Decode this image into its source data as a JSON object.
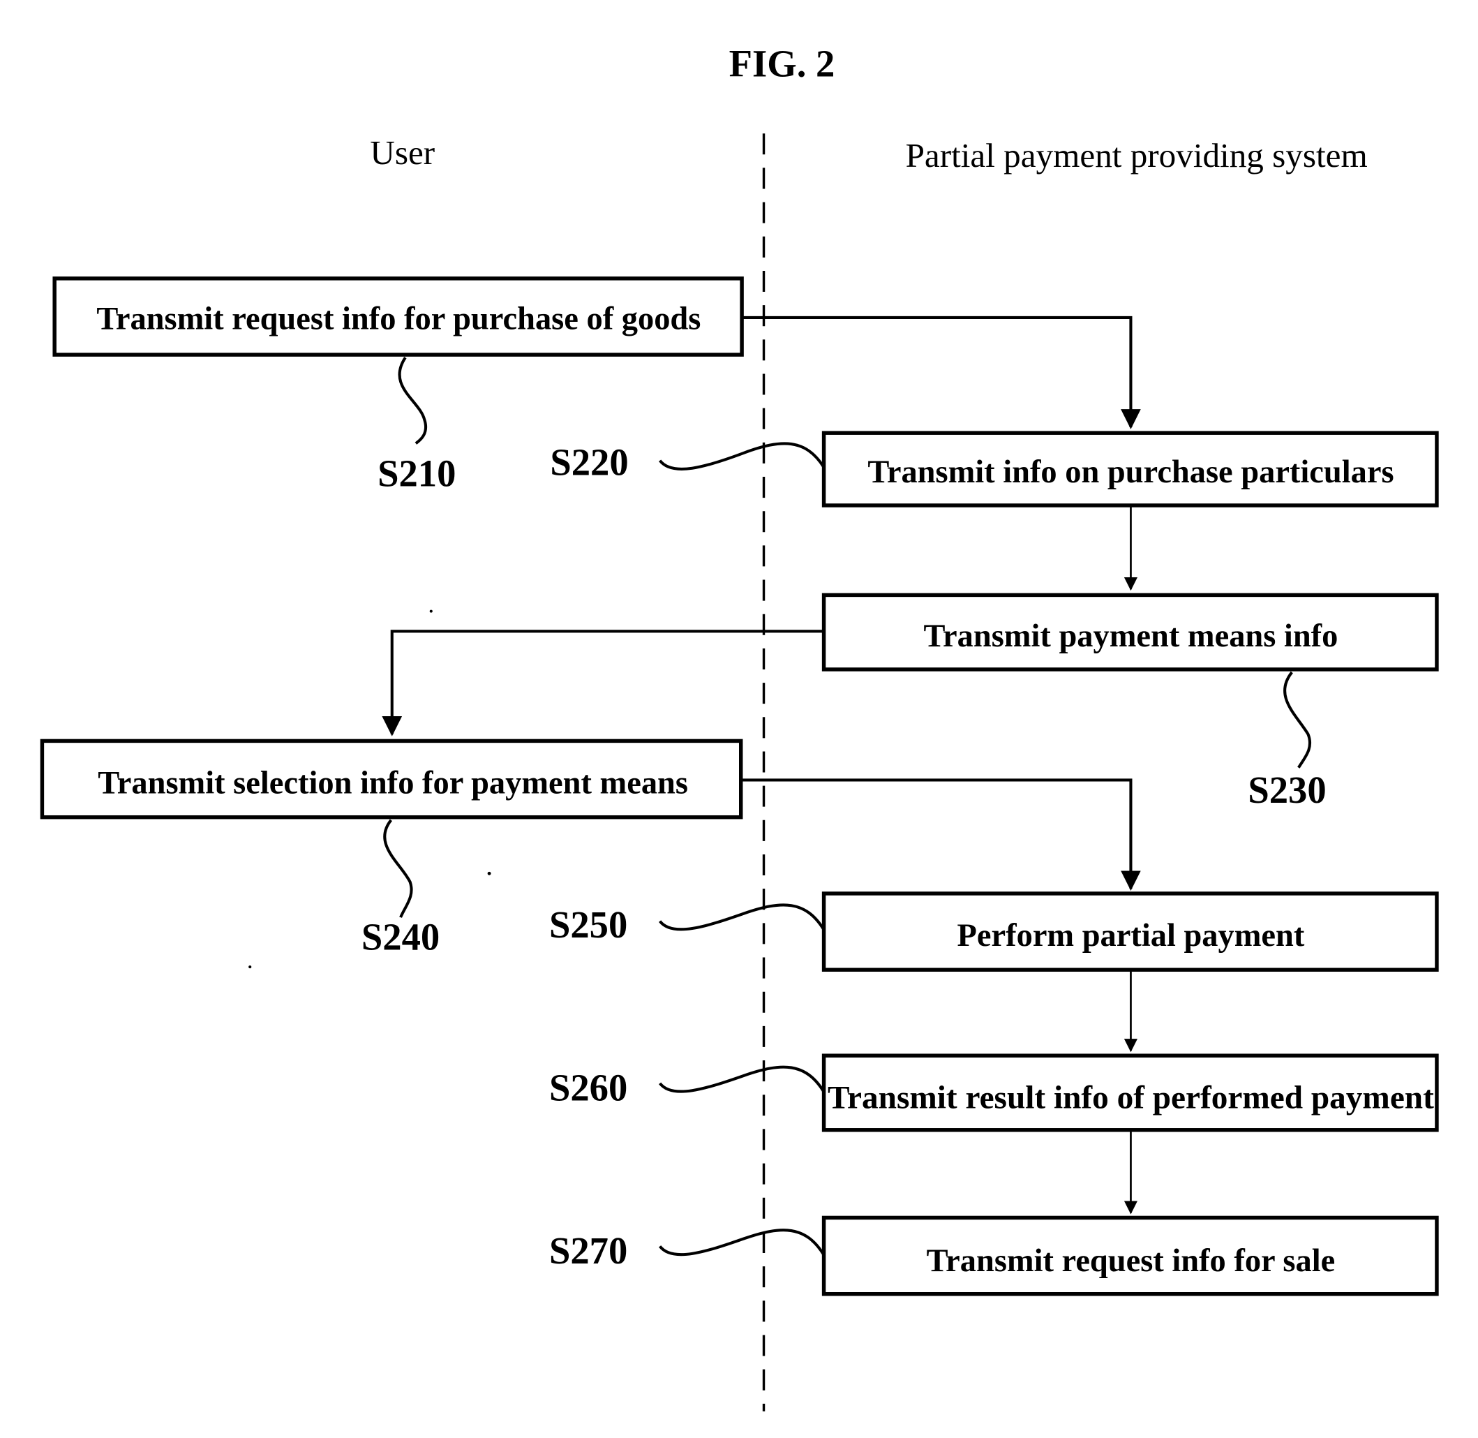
{
  "figure": {
    "title": "FIG. 2",
    "lanes": {
      "left": "User",
      "right": "Partial payment providing system"
    },
    "steps": [
      {
        "id": "S210",
        "label": "Transmit request info for purchase of goods",
        "lane": "User"
      },
      {
        "id": "S220",
        "label": "Transmit info on purchase particulars",
        "lane": "Partial payment providing system"
      },
      {
        "id": "S230",
        "label": "Transmit payment means info",
        "lane": "Partial payment providing system"
      },
      {
        "id": "S240",
        "label": "Transmit selection info for payment means",
        "lane": "User"
      },
      {
        "id": "S250",
        "label": "Perform partial payment",
        "lane": "Partial payment providing system"
      },
      {
        "id": "S260",
        "label": "Transmit result info of performed payment",
        "lane": "Partial payment providing system"
      },
      {
        "id": "S270",
        "label": "Transmit request info for sale",
        "lane": "Partial payment providing system"
      }
    ],
    "flow": [
      [
        "S210",
        "S220"
      ],
      [
        "S220",
        "S230"
      ],
      [
        "S230",
        "S240"
      ],
      [
        "S240",
        "S250"
      ],
      [
        "S250",
        "S260"
      ],
      [
        "S260",
        "S270"
      ]
    ]
  }
}
